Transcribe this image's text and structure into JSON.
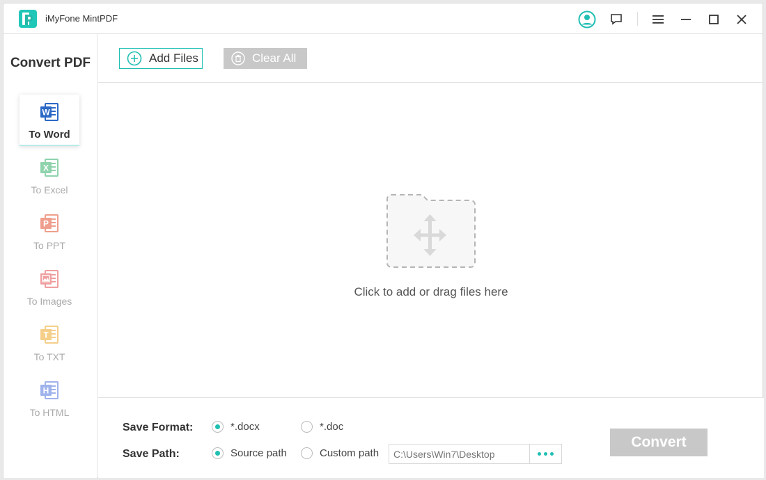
{
  "app": {
    "title": "iMyFone MintPDF"
  },
  "sidebar": {
    "title": "Convert PDF",
    "items": [
      {
        "label": "To Word",
        "letter": "W",
        "color": "#2b69c6",
        "active": true
      },
      {
        "label": "To Excel",
        "letter": "X",
        "color": "#8fd3ad",
        "active": false
      },
      {
        "label": "To PPT",
        "letter": "P",
        "color": "#ef9f8d",
        "active": false
      },
      {
        "label": "To Images",
        "letter": "",
        "color": "#ef9f9f",
        "active": false
      },
      {
        "label": "To TXT",
        "letter": "T",
        "color": "#f5cf8a",
        "active": false
      },
      {
        "label": "To HTML",
        "letter": "H",
        "color": "#9fb3ec",
        "active": false
      }
    ]
  },
  "toolbar": {
    "add_label": "Add Files",
    "clear_label": "Clear All"
  },
  "drop": {
    "text": "Click to add or drag files here"
  },
  "settings": {
    "format_label": "Save Format:",
    "format_options": [
      "*.docx",
      "*.doc"
    ],
    "format_selected": "*.docx",
    "path_label": "Save Path:",
    "path_options": [
      "Source path",
      "Custom path"
    ],
    "path_selected": "Source path",
    "path_placeholder": "C:\\Users\\Win7\\Desktop"
  },
  "convert_label": "Convert",
  "colors": {
    "accent": "#20bfb3",
    "disabled": "#c8c8c8"
  }
}
